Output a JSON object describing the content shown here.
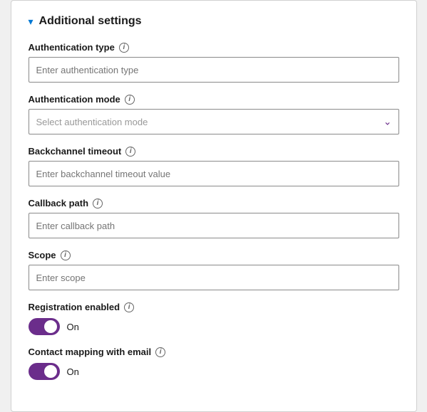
{
  "section": {
    "title": "Additional settings",
    "chevron": "▾"
  },
  "fields": {
    "authType": {
      "label": "Authentication type",
      "placeholder": "Enter authentication type"
    },
    "authMode": {
      "label": "Authentication mode",
      "placeholder": "Select authentication mode"
    },
    "backchannelTimeout": {
      "label": "Backchannel timeout",
      "placeholder": "Enter backchannel timeout value"
    },
    "callbackPath": {
      "label": "Callback path",
      "placeholder": "Enter callback path"
    },
    "scope": {
      "label": "Scope",
      "placeholder": "Enter scope"
    }
  },
  "toggles": {
    "registrationEnabled": {
      "label": "Registration enabled",
      "statusLabel": "On"
    },
    "contactMapping": {
      "label": "Contact mapping with email",
      "statusLabel": "On"
    }
  }
}
